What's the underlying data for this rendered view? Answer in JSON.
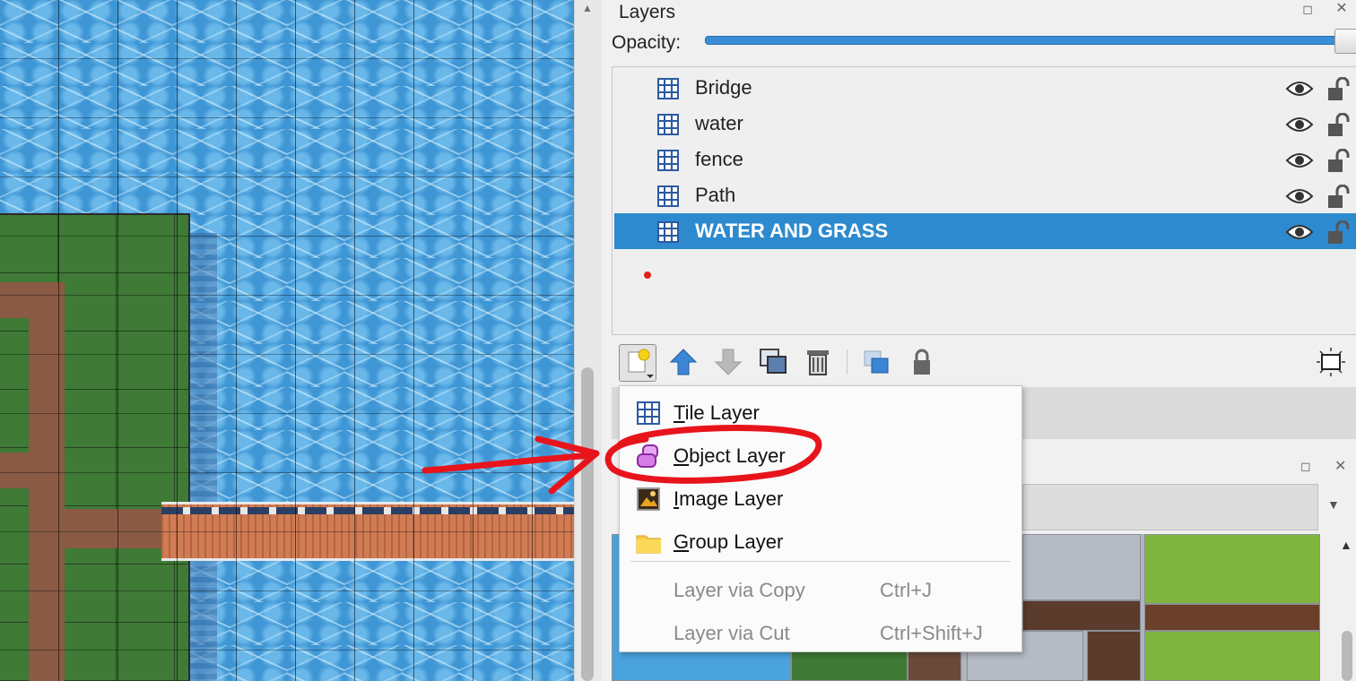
{
  "layers_panel": {
    "title": "Layers",
    "opacity_label": "Opacity:",
    "opacity_value": 1.0,
    "layers": [
      {
        "name": "Bridge",
        "type": "tile-layer-icon",
        "visible": true,
        "locked": false,
        "selected": false
      },
      {
        "name": "water",
        "type": "tile-layer-icon",
        "visible": true,
        "locked": false,
        "selected": false
      },
      {
        "name": "fence",
        "type": "tile-layer-icon",
        "visible": true,
        "locked": false,
        "selected": false
      },
      {
        "name": "Path",
        "type": "tile-layer-icon",
        "visible": true,
        "locked": false,
        "selected": false
      },
      {
        "name": "WATER AND GRASS",
        "type": "tile-layer-icon",
        "visible": true,
        "locked": false,
        "selected": true
      }
    ],
    "toolbar_icons": [
      "new-layer-icon",
      "raise-layer-icon",
      "lower-layer-icon",
      "duplicate-layer-icon",
      "delete-layer-icon",
      "show-hide-others-icon",
      "lock-layer-icon",
      "highlight-current-layer-icon"
    ]
  },
  "new_layer_menu": {
    "items": [
      {
        "mnemonic": "T",
        "rest": "ile Layer",
        "icon": "tile-layer-icon",
        "enabled": true
      },
      {
        "mnemonic": "O",
        "rest": "bject Layer",
        "icon": "object-layer-icon",
        "enabled": true
      },
      {
        "mnemonic": "I",
        "rest": "mage Layer",
        "icon": "image-layer-icon",
        "enabled": true
      },
      {
        "mnemonic": "G",
        "rest": "roup Layer",
        "icon": "folder-icon",
        "enabled": true
      }
    ],
    "disabled_items": [
      {
        "label": "Layer via Copy",
        "shortcut": "Ctrl+J",
        "enabled": false
      },
      {
        "label": "Layer via Cut",
        "shortcut": "Ctrl+Shift+J",
        "enabled": false
      }
    ]
  },
  "colors": {
    "selection": "#2e8ace",
    "annotation": "#e8141c",
    "grass": "#3f7a36",
    "path": "#8a5a45",
    "water": "#4ba3de"
  }
}
